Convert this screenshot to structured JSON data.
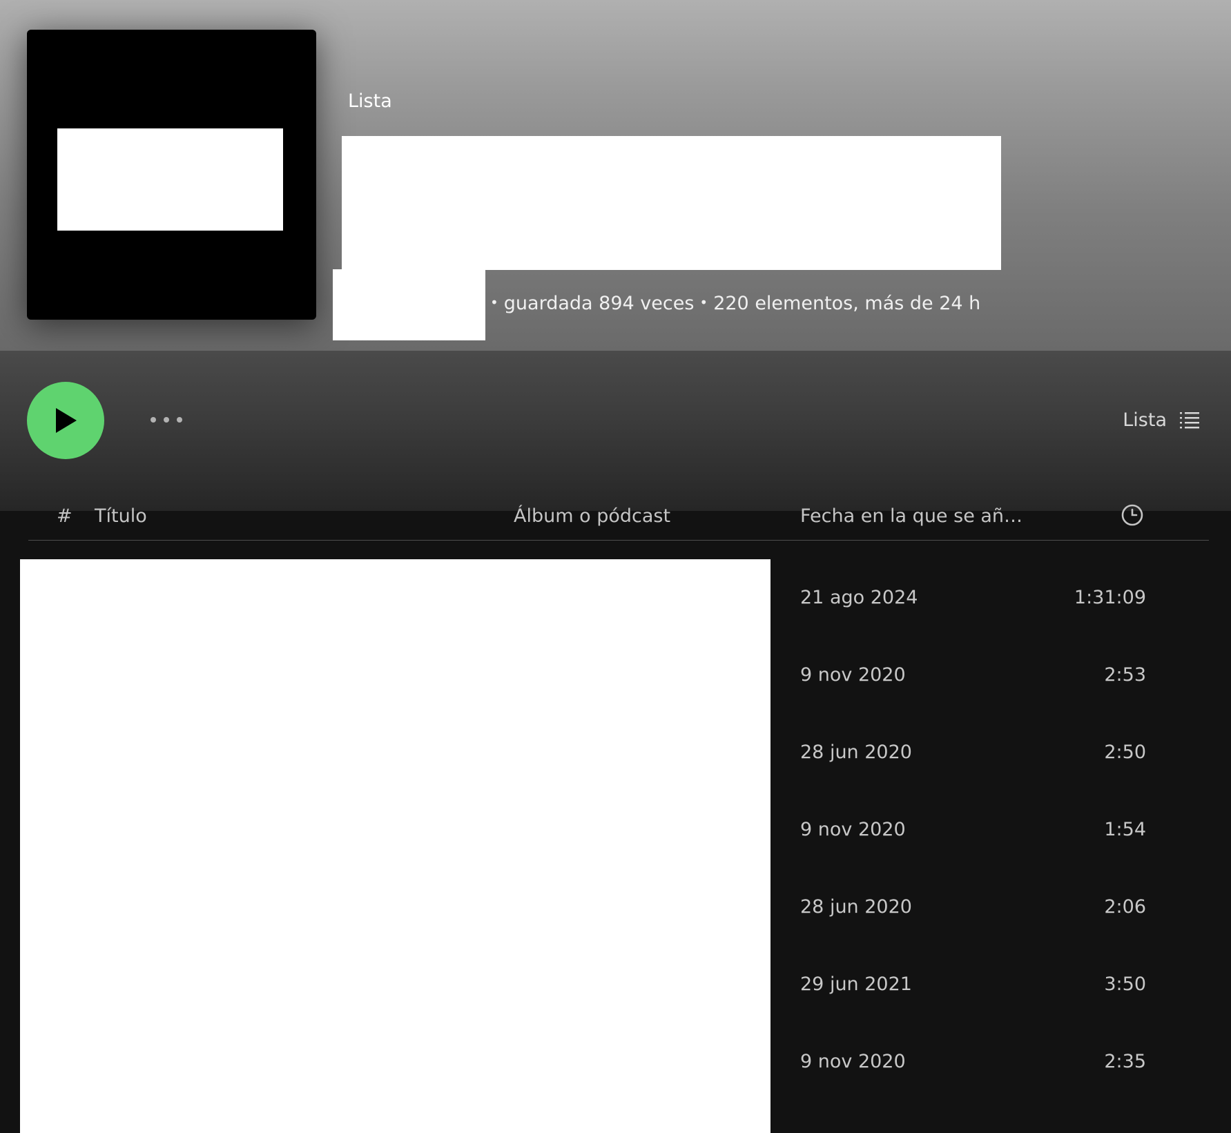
{
  "playlist": {
    "type_label": "Lista",
    "meta": {
      "saves": "guardada 894 veces",
      "items": "220 elementos, más de 24 h",
      "separator": "•"
    }
  },
  "actions": {
    "view_label": "Lista"
  },
  "table": {
    "headers": {
      "number": "#",
      "title": "Título",
      "album": "Álbum o pódcast",
      "date_added": "Fecha en la que se añ…"
    },
    "rows": [
      {
        "date": "21 ago 2024",
        "duration": "1:31:09"
      },
      {
        "date": "9 nov 2020",
        "duration": "2:53"
      },
      {
        "date": "28 jun 2020",
        "duration": "2:50"
      },
      {
        "date": "9 nov 2020",
        "duration": "1:54"
      },
      {
        "date": "28 jun 2020",
        "duration": "2:06"
      },
      {
        "date": "29 jun 2021",
        "duration": "3:50"
      },
      {
        "date": "9 nov 2020",
        "duration": "2:35"
      }
    ]
  },
  "colors": {
    "accent_play": "#5fd36f",
    "background": "#121212"
  },
  "icons": [
    "play-icon",
    "more-options-icon",
    "list-view-icon",
    "clock-icon"
  ]
}
